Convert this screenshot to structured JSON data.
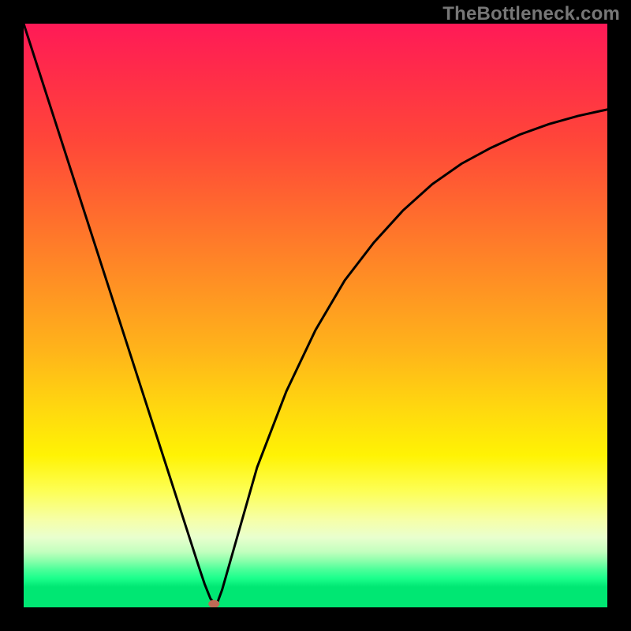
{
  "watermark": "TheBottleneck.com",
  "chart_data": {
    "type": "line",
    "title": "",
    "xlabel": "",
    "ylabel": "",
    "xlim": [
      0,
      100
    ],
    "ylim": [
      0,
      100
    ],
    "grid": false,
    "legend": false,
    "series": [
      {
        "name": "bottleneck-curve",
        "x": [
          0,
          5,
          10,
          15,
          20,
          25,
          28,
          30,
          31,
          32,
          33,
          34,
          36,
          40,
          45,
          50,
          55,
          60,
          65,
          70,
          75,
          80,
          85,
          90,
          95,
          100
        ],
        "y": [
          100,
          84.5,
          69,
          53.5,
          38,
          22.5,
          13.2,
          7,
          4,
          1.5,
          0.3,
          3,
          10,
          24,
          37,
          47.5,
          56,
          62.5,
          68,
          72.5,
          76,
          78.7,
          81,
          82.8,
          84.2,
          85.3
        ]
      }
    ],
    "marker": {
      "x": 32.6,
      "y": 0.6,
      "color": "#c06a56"
    },
    "background_gradient_stops": [
      {
        "pos": 0.0,
        "color": "#ff1a57"
      },
      {
        "pos": 0.2,
        "color": "#ff4639"
      },
      {
        "pos": 0.44,
        "color": "#ff8f24"
      },
      {
        "pos": 0.66,
        "color": "#ffd80f"
      },
      {
        "pos": 0.8,
        "color": "#fdff54"
      },
      {
        "pos": 0.9,
        "color": "#c2ffbe"
      },
      {
        "pos": 0.95,
        "color": "#1cff8c"
      },
      {
        "pos": 1.0,
        "color": "#00e773"
      }
    ]
  }
}
